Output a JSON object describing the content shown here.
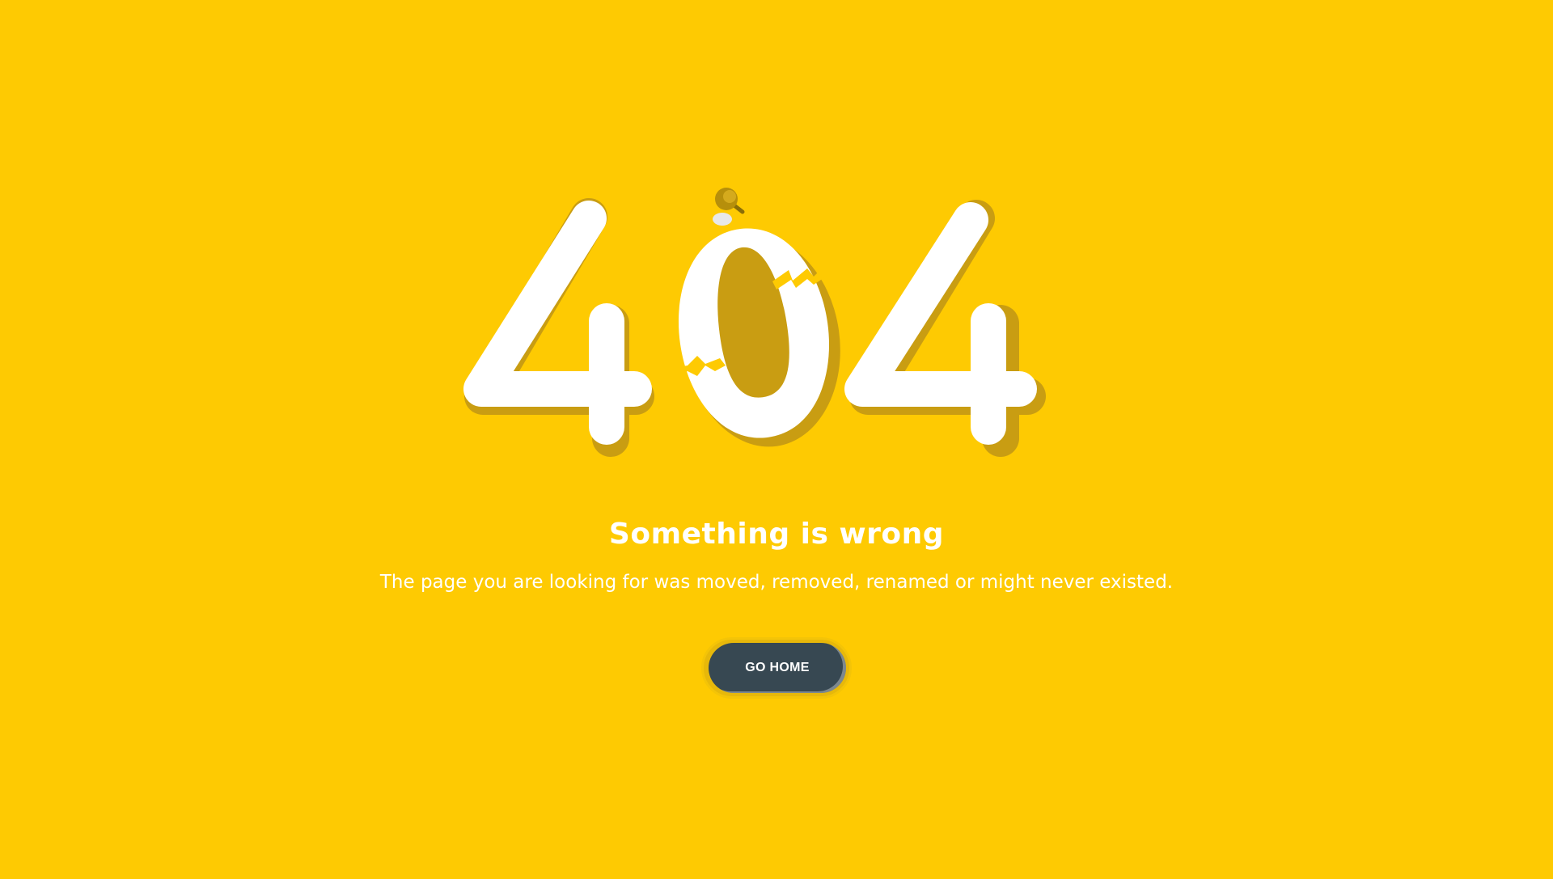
{
  "error": {
    "code_digits": [
      "4",
      "0",
      "4"
    ],
    "title": "Something is wrong",
    "message": "The page you are looking for was moved, removed, renamed or might never existed."
  },
  "actions": {
    "home_label": "GO HOME"
  },
  "colors": {
    "background": "#FECA02",
    "digit_fill": "#FFFFFF",
    "digit_shadow": "#C99D12",
    "button": "#374852",
    "button_ring": "#E7B80A"
  },
  "icons": {
    "pin": "pin-icon"
  }
}
